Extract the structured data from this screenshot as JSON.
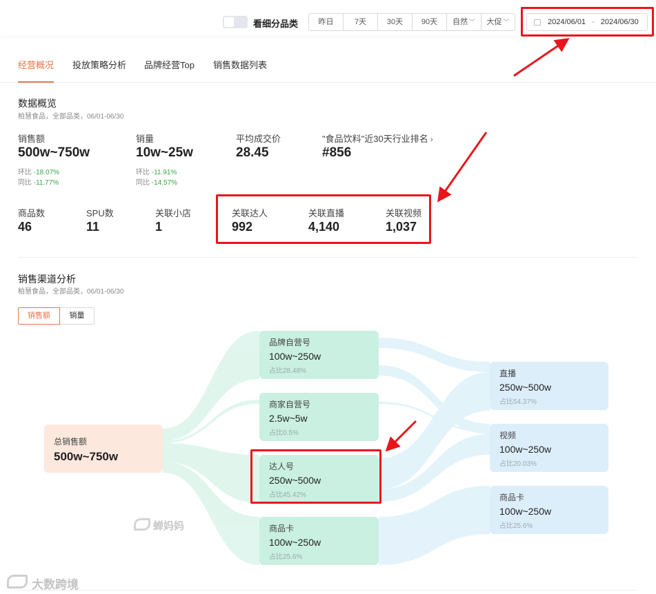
{
  "header": {
    "toggle_label": "看细分品类",
    "periods": [
      {
        "label": "昨日",
        "dropdown": false
      },
      {
        "label": "7天",
        "dropdown": false
      },
      {
        "label": "30天",
        "dropdown": false
      },
      {
        "label": "90天",
        "dropdown": false
      },
      {
        "label": "自然",
        "dropdown": true
      },
      {
        "label": "大促",
        "dropdown": true
      }
    ],
    "date_start": "2024/06/01",
    "date_sep": "-",
    "date_end": "2024/06/30"
  },
  "tabs": [
    {
      "label": "经营概况",
      "active": true
    },
    {
      "label": "投放策略分析",
      "active": false
    },
    {
      "label": "品牌经营Top",
      "active": false
    },
    {
      "label": "销售数据列表",
      "active": false
    }
  ],
  "overview": {
    "title": "数据概览",
    "subtitle": "柏慧食品，全部品类，06/01-06/30",
    "metrics": [
      {
        "label": "销售额",
        "value": "500w~750w",
        "mom_label": "环比",
        "mom": "-18.07%",
        "yoy_label": "同比",
        "yoy": "-11.77%"
      },
      {
        "label": "销量",
        "value": "10w~25w",
        "mom_label": "环比",
        "mom": "-11.91%",
        "yoy_label": "同比",
        "yoy": "-14.57%"
      },
      {
        "label": "平均成交价",
        "value": "28.45"
      },
      {
        "label": "\"食品饮料\"近30天行业排名",
        "value": "#856",
        "link": true
      }
    ],
    "counts": [
      {
        "label": "商品数",
        "value": "46"
      },
      {
        "label": "SPU数",
        "value": "11"
      },
      {
        "label": "关联小店",
        "value": "1"
      },
      {
        "label": "关联达人",
        "value": "992"
      },
      {
        "label": "关联直播",
        "value": "4,140"
      },
      {
        "label": "关联视频",
        "value": "1,037"
      }
    ]
  },
  "channel": {
    "title": "销售渠道分析",
    "subtitle": "柏慧食品，全部品类，06/01-06/30",
    "toggles": [
      {
        "label": "销售额",
        "active": true
      },
      {
        "label": "销量",
        "active": false
      }
    ],
    "source": {
      "label": "总销售额",
      "value": "500w~750w"
    },
    "middle": [
      {
        "label": "品牌自营号",
        "value": "100w~250w",
        "pct": "占比28.48%"
      },
      {
        "label": "商家自营号",
        "value": "2.5w~5w",
        "pct": "占比0.5%"
      },
      {
        "label": "达人号",
        "value": "250w~500w",
        "pct": "占比45.42%"
      },
      {
        "label": "商品卡",
        "value": "100w~250w",
        "pct": "占比25.6%"
      }
    ],
    "targets": [
      {
        "label": "直播",
        "value": "250w~500w",
        "pct": "占比54.37%"
      },
      {
        "label": "视频",
        "value": "100w~250w",
        "pct": "占比20.03%"
      },
      {
        "label": "商品卡",
        "value": "100w~250w",
        "pct": "占比25.6%"
      }
    ]
  },
  "watermarks": {
    "center": "蝉妈妈",
    "corner": "大数跨境"
  },
  "colors": {
    "accent": "#e8744a",
    "positive": "#3aa64a",
    "annotation": "#e8161c",
    "source_node": "#fde8de",
    "middle_node": "#c9f0e1",
    "target_node": "#ddeefb"
  }
}
